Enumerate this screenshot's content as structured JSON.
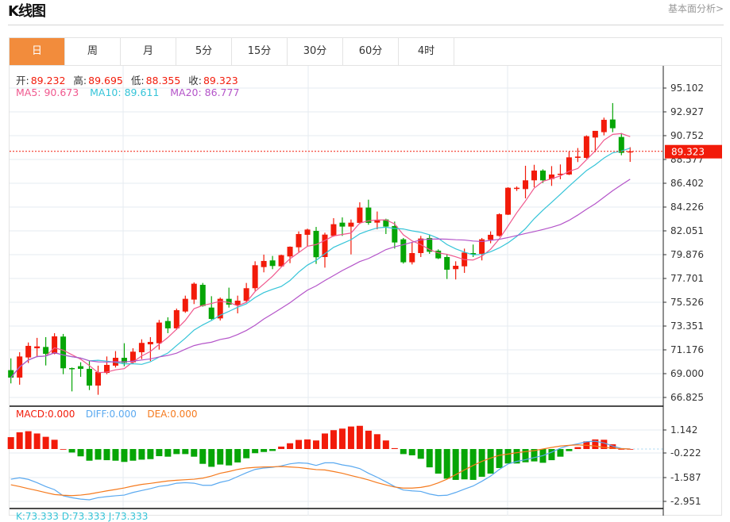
{
  "header": {
    "title": "K线图",
    "link": "基本面分析>"
  },
  "tabs": [
    {
      "label": "日",
      "active": true
    },
    {
      "label": "周"
    },
    {
      "label": "月"
    },
    {
      "label": "5分"
    },
    {
      "label": "15分"
    },
    {
      "label": "30分"
    },
    {
      "label": "60分"
    },
    {
      "label": "4时"
    }
  ],
  "ohlc": {
    "open_label": "开:",
    "open": "89.232",
    "high_label": "高:",
    "high": "89.695",
    "low_label": "低:",
    "low": "88.355",
    "close_label": "收:",
    "close": "89.323"
  },
  "ma": {
    "ma5": "MA5: 90.673",
    "ma10": "MA10: 89.611",
    "ma20": "MA20: 86.777"
  },
  "macd_info": {
    "macd": "MACD:0.000",
    "diff": "DIFF:0.000",
    "dea": "DEA:0.000"
  },
  "kdj_info": {
    "text": "K:73.333   D:73.333   J:73.333"
  },
  "colors": {
    "up": "#f21b0a",
    "down": "#06a506",
    "ma5": "#f0588e",
    "ma10": "#35c4d8",
    "ma20": "#b454c9",
    "diff": "#5aa9f0",
    "dea": "#f57a1e",
    "accent": "#f28c3c"
  },
  "chart_data": [
    {
      "type": "candlestick",
      "current_price": "89.323",
      "y_ticks": [
        "95.102",
        "92.927",
        "90.752",
        "88.577",
        "86.402",
        "84.226",
        "82.051",
        "79.876",
        "77.701",
        "75.526",
        "73.351",
        "71.176",
        "69.000",
        "66.825"
      ],
      "ylim": [
        66.825,
        95.102
      ],
      "ohlc": [
        [
          69.32,
          70.4,
          68.11,
          68.64
        ],
        [
          68.64,
          70.96,
          67.99,
          70.57
        ],
        [
          70.48,
          71.85,
          69.97,
          71.54
        ],
        [
          71.32,
          72.27,
          70.6,
          71.49
        ],
        [
          71.44,
          72.34,
          69.75,
          70.81
        ],
        [
          70.81,
          72.7,
          70.77,
          72.41
        ],
        [
          72.39,
          72.63,
          68.95,
          69.49
        ],
        [
          69.51,
          69.56,
          67.38,
          69.44
        ],
        [
          69.68,
          70.04,
          68.71,
          69.44
        ],
        [
          69.44,
          70.16,
          67.5,
          67.91
        ],
        [
          67.91,
          69.73,
          67.07,
          69.15
        ],
        [
          69.07,
          70.57,
          68.95,
          69.8
        ],
        [
          69.73,
          71.06,
          69.56,
          70.45
        ],
        [
          70.45,
          71.78,
          69.68,
          69.99
        ],
        [
          70.04,
          71.32,
          69.92,
          71.01
        ],
        [
          70.96,
          72.14,
          70.33,
          71.81
        ],
        [
          71.68,
          72.34,
          70.16,
          71.9
        ],
        [
          71.78,
          73.91,
          71.2,
          73.67
        ],
        [
          73.81,
          74.15,
          72.7,
          73.14
        ],
        [
          73.14,
          74.95,
          73.01,
          74.8
        ],
        [
          74.68,
          76.13,
          74.56,
          75.84
        ],
        [
          75.77,
          77.34,
          75.36,
          77.22
        ],
        [
          77.12,
          77.29,
          75.12,
          75.19
        ],
        [
          75.04,
          76.08,
          73.91,
          74.0
        ],
        [
          74.05,
          75.96,
          73.86,
          75.84
        ],
        [
          75.84,
          76.86,
          75.04,
          75.31
        ],
        [
          75.26,
          76.13,
          74.51,
          75.67
        ],
        [
          75.65,
          77.29,
          75.48,
          76.81
        ],
        [
          76.81,
          79.27,
          76.57,
          78.91
        ],
        [
          78.74,
          79.88,
          78.26,
          79.3
        ],
        [
          79.35,
          79.76,
          78.55,
          78.84
        ],
        [
          78.81,
          79.88,
          78.74,
          79.83
        ],
        [
          79.71,
          80.63,
          79.1,
          80.6
        ],
        [
          80.55,
          82.0,
          80.12,
          81.76
        ],
        [
          81.69,
          82.25,
          80.67,
          82.17
        ],
        [
          82.05,
          82.41,
          79.03,
          79.64
        ],
        [
          79.66,
          81.88,
          78.69,
          81.71
        ],
        [
          81.59,
          83.21,
          81.52,
          82.66
        ],
        [
          82.8,
          83.28,
          81.59,
          82.44
        ],
        [
          82.44,
          83.09,
          79.9,
          82.8
        ],
        [
          82.78,
          84.66,
          82.68,
          84.18
        ],
        [
          84.18,
          84.9,
          82.61,
          82.78
        ],
        [
          82.8,
          83.82,
          82.2,
          83.04
        ],
        [
          83.09,
          83.16,
          81.76,
          82.44
        ],
        [
          82.49,
          82.9,
          80.43,
          80.99
        ],
        [
          81.28,
          81.4,
          79.06,
          79.18
        ],
        [
          79.18,
          80.99,
          78.98,
          80.02
        ],
        [
          80.02,
          81.59,
          79.66,
          81.35
        ],
        [
          81.4,
          81.69,
          79.95,
          80.14
        ],
        [
          80.24,
          80.36,
          79.47,
          79.54
        ],
        [
          79.66,
          79.95,
          77.65,
          78.5
        ],
        [
          78.55,
          79.27,
          77.61,
          78.86
        ],
        [
          78.81,
          80.43,
          78.21,
          80.07
        ],
        [
          80.02,
          80.8,
          79.66,
          79.95
        ],
        [
          79.95,
          81.4,
          79.35,
          81.28
        ],
        [
          81.23,
          82.0,
          80.92,
          81.69
        ],
        [
          81.59,
          83.65,
          81.52,
          83.57
        ],
        [
          83.53,
          86.04,
          83.5,
          85.99
        ],
        [
          85.92,
          86.11,
          85.7,
          85.99
        ],
        [
          85.87,
          88.0,
          85.02,
          86.67
        ],
        [
          86.67,
          88.09,
          86.04,
          87.56
        ],
        [
          87.56,
          87.68,
          86.43,
          86.67
        ],
        [
          86.79,
          87.97,
          86.16,
          87.2
        ],
        [
          87.2,
          88.12,
          86.77,
          87.27
        ],
        [
          87.2,
          89.3,
          87.15,
          88.77
        ],
        [
          88.72,
          89.62,
          88.34,
          88.84
        ],
        [
          88.72,
          90.78,
          88.65,
          90.7
        ],
        [
          90.58,
          91.19,
          89.25,
          91.19
        ],
        [
          91.07,
          92.4,
          90.78,
          92.2
        ],
        [
          92.23,
          93.73,
          91.07,
          91.43
        ],
        [
          90.63,
          90.99,
          88.96,
          89.18
        ],
        [
          89.232,
          89.695,
          88.355,
          89.323
        ]
      ],
      "ohlc_order": [
        "open",
        "high",
        "low",
        "close"
      ],
      "overlays": [
        "MA5",
        "MA10",
        "MA20"
      ]
    },
    {
      "type": "bar+line",
      "y_ticks": [
        "1.142",
        "-0.222",
        "-1.587",
        "-2.951"
      ],
      "ylim": [
        -3.5,
        1.6
      ],
      "macd": [
        0.68,
        0.96,
        1.02,
        0.89,
        0.7,
        0.53,
        0.0,
        -0.2,
        -0.42,
        -0.67,
        -0.61,
        -0.64,
        -0.67,
        -0.74,
        -0.67,
        -0.61,
        -0.58,
        -0.41,
        -0.44,
        -0.29,
        -0.29,
        -0.44,
        -0.85,
        -1.02,
        -0.89,
        -0.94,
        -0.77,
        -0.53,
        -0.24,
        -0.17,
        -0.11,
        0.14,
        0.33,
        0.52,
        0.55,
        0.49,
        0.89,
        1.08,
        1.17,
        1.29,
        1.33,
        1.05,
        0.85,
        0.49,
        0.05,
        -0.29,
        -0.36,
        -0.56,
        -1.05,
        -1.41,
        -1.7,
        -1.77,
        -1.74,
        -1.77,
        -1.59,
        -1.41,
        -1.09,
        -0.83,
        -0.83,
        -0.76,
        -0.71,
        -0.79,
        -0.64,
        -0.44,
        -0.12,
        0.11,
        0.44,
        0.55,
        0.53,
        0.27,
        0.0,
        0.0
      ],
      "diff": [
        -1.73,
        -1.65,
        -1.74,
        -1.93,
        -2.15,
        -2.33,
        -2.68,
        -2.79,
        -2.87,
        -2.91,
        -2.79,
        -2.73,
        -2.68,
        -2.64,
        -2.49,
        -2.38,
        -2.27,
        -2.14,
        -2.08,
        -1.96,
        -1.93,
        -1.96,
        -2.08,
        -2.08,
        -1.91,
        -1.8,
        -1.58,
        -1.36,
        -1.17,
        -1.09,
        -1.05,
        -0.97,
        -0.85,
        -0.79,
        -0.82,
        -0.94,
        -0.79,
        -0.79,
        -0.91,
        -0.99,
        -1.12,
        -1.39,
        -1.62,
        -1.88,
        -2.15,
        -2.35,
        -2.4,
        -2.43,
        -2.58,
        -2.67,
        -2.65,
        -2.49,
        -2.3,
        -2.12,
        -1.85,
        -1.55,
        -1.17,
        -0.86,
        -0.71,
        -0.61,
        -0.49,
        -0.38,
        -0.18,
        0.05,
        0.2,
        0.3,
        0.42,
        0.45,
        0.35,
        0.17,
        0.03,
        0.0
      ],
      "dea": [
        -2.05,
        -2.15,
        -2.27,
        -2.38,
        -2.5,
        -2.61,
        -2.65,
        -2.67,
        -2.64,
        -2.58,
        -2.49,
        -2.4,
        -2.32,
        -2.23,
        -2.12,
        -2.03,
        -1.97,
        -1.9,
        -1.83,
        -1.79,
        -1.76,
        -1.73,
        -1.67,
        -1.55,
        -1.39,
        -1.29,
        -1.17,
        -1.09,
        -1.05,
        -1.03,
        -1.02,
        -1.0,
        -1.03,
        -1.06,
        -1.12,
        -1.18,
        -1.2,
        -1.29,
        -1.39,
        -1.52,
        -1.64,
        -1.77,
        -1.93,
        -2.06,
        -2.18,
        -2.24,
        -2.24,
        -2.2,
        -2.11,
        -1.94,
        -1.73,
        -1.47,
        -1.2,
        -0.94,
        -0.71,
        -0.52,
        -0.36,
        -0.29,
        -0.21,
        -0.15,
        -0.09,
        0.0,
        0.09,
        0.17,
        0.21,
        0.24,
        0.21,
        0.17,
        0.09,
        0.05,
        0.02,
        0.0
      ]
    }
  ]
}
